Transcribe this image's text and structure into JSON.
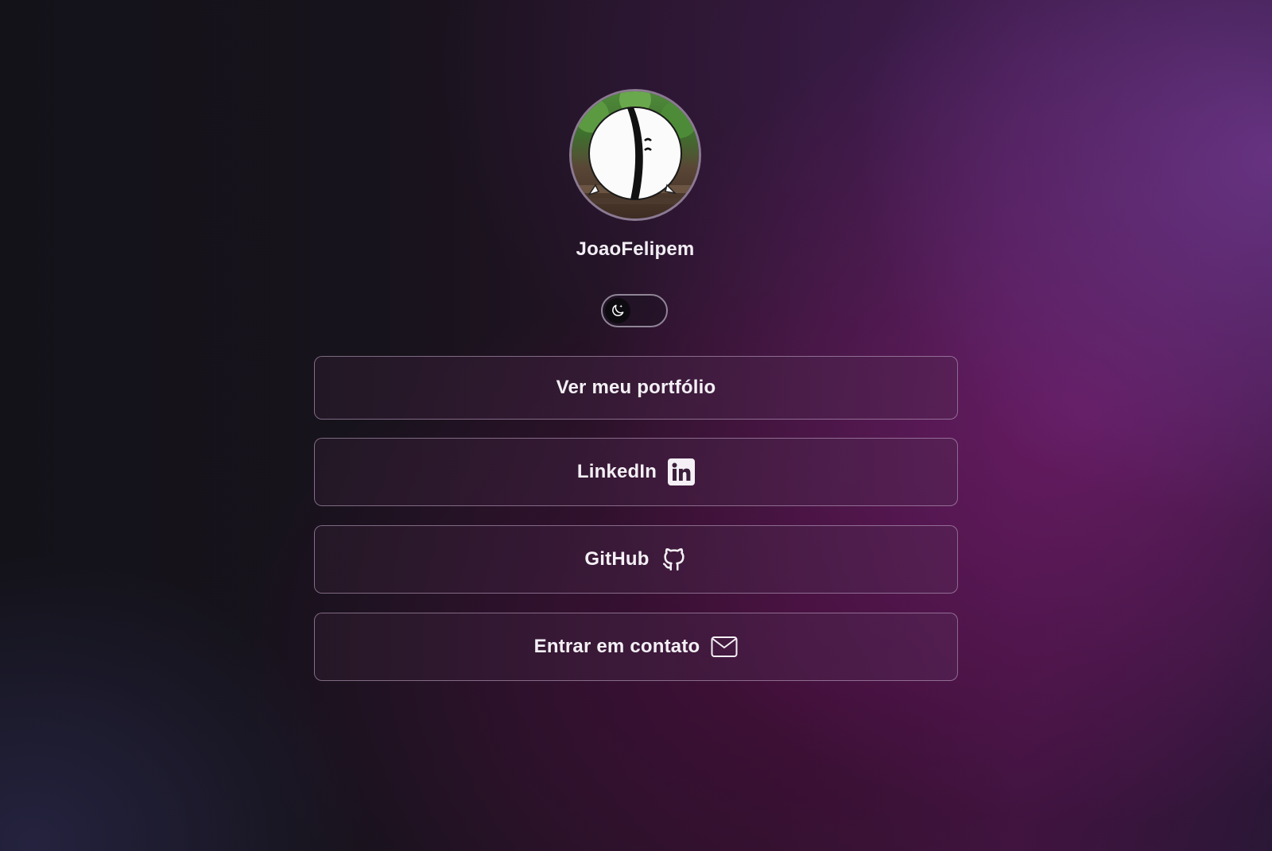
{
  "profile": {
    "username": "JoaoFelipem",
    "avatar_icon": "avatar-image"
  },
  "theme_toggle": {
    "icon": "moon-icon",
    "state": "dark"
  },
  "links": {
    "portfolio": {
      "label": "Ver meu portfólio"
    },
    "linkedin": {
      "label": "LinkedIn",
      "icon": "linkedin-icon"
    },
    "github": {
      "label": "GitHub",
      "icon": "github-icon"
    },
    "contact": {
      "label": "Entrar em contato",
      "icon": "mail-icon"
    }
  },
  "colors": {
    "text": "#f3eef5",
    "button_border": "#c8afcd",
    "accent_purple": "#6e378c"
  }
}
